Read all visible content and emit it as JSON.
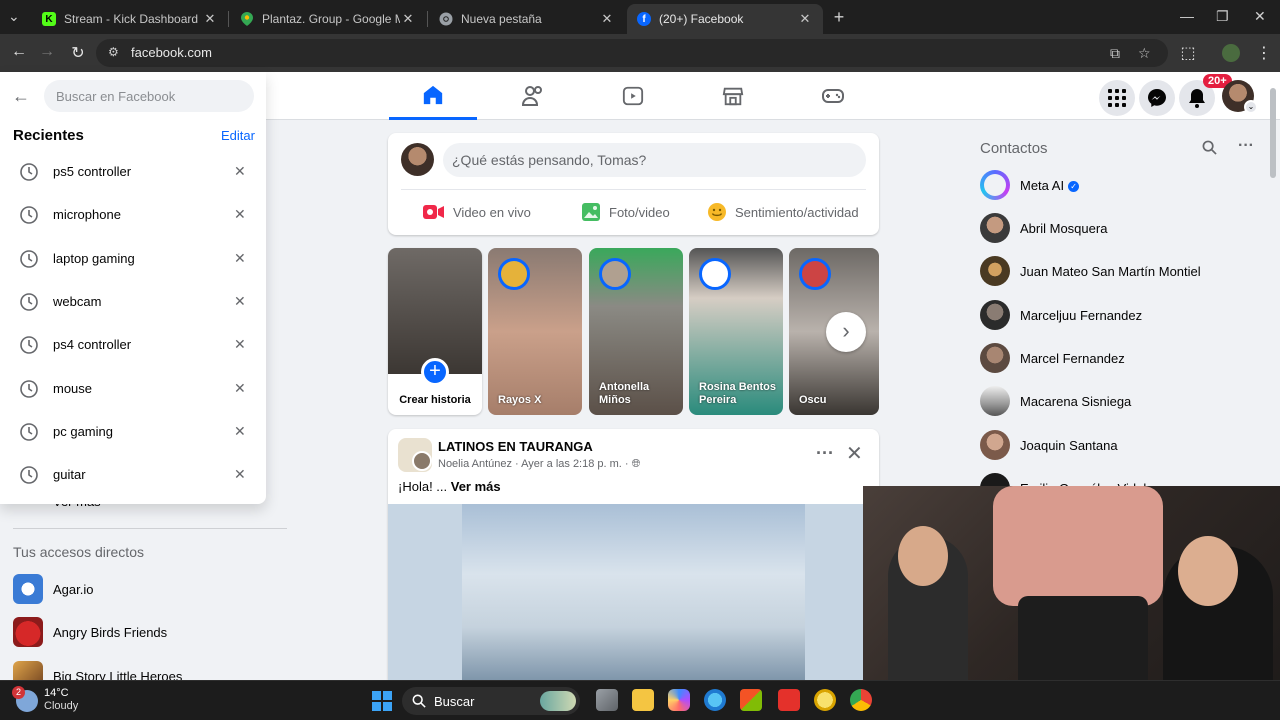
{
  "browser": {
    "tabs": [
      {
        "title": "Stream - Kick Dashboard",
        "favicon": "kick-icon",
        "color": "#53fc18"
      },
      {
        "title": "Plantaz. Group - Google Maps",
        "favicon": "maps-pin-icon",
        "color": "#34a853"
      },
      {
        "title": "Nueva pestaña",
        "favicon": "chrome-icon",
        "color": "#9aa0a6"
      },
      {
        "title": "(20+) Facebook",
        "favicon": "facebook-icon",
        "color": "#0866ff"
      }
    ],
    "active_tab": 3,
    "url": "facebook.com"
  },
  "facebook": {
    "accent": "#0866ff",
    "notifications_badge": "20+",
    "search": {
      "placeholder": "Buscar en Facebook",
      "recent_title": "Recientes",
      "edit_label": "Editar",
      "recent_items": [
        "ps5 controller",
        "microphone",
        "laptop gaming",
        "webcam",
        "ps4 controller",
        "mouse",
        "pc gaming",
        "guitar"
      ]
    },
    "left": {
      "ver_mas": "Ver más",
      "shortcuts_title": "Tus accesos directos",
      "shortcuts": [
        "Agar.io",
        "Angry Birds Friends",
        "Big Story Little Heroes"
      ]
    },
    "composer": {
      "placeholder": "¿Qué estás pensando, Tomas?",
      "actions": [
        "Video en vivo",
        "Foto/video",
        "Sentimiento/actividad"
      ]
    },
    "stories": [
      {
        "name": "Crear historia"
      },
      {
        "name": "Rayos X"
      },
      {
        "name": "Antonella Miños"
      },
      {
        "name": "Rosina Bentos Pereira"
      },
      {
        "name": "Oscu"
      }
    ],
    "post": {
      "group": "LATINOS EN TAURANGA",
      "author": "Noelia Antúnez",
      "time": "Ayer a las 2:18 p. m.",
      "text": "¡Hola!  ...",
      "see_more": "Ver más"
    },
    "contacts": {
      "title": "Contactos",
      "items": [
        {
          "name": "Meta AI",
          "verified": true
        },
        {
          "name": "Abril Mosquera"
        },
        {
          "name": "Juan Mateo San Martín Montiel"
        },
        {
          "name": "Marceljuu Fernandez"
        },
        {
          "name": "Marcel Fernandez"
        },
        {
          "name": "Macarena Sisniega"
        },
        {
          "name": "Joaquin Santana"
        },
        {
          "name": "Emilio González Vidal"
        }
      ]
    }
  },
  "taskbar": {
    "weather_temp": "14°C",
    "weather_desc": "Cloudy",
    "weather_badge": "2",
    "search_label": "Buscar"
  }
}
